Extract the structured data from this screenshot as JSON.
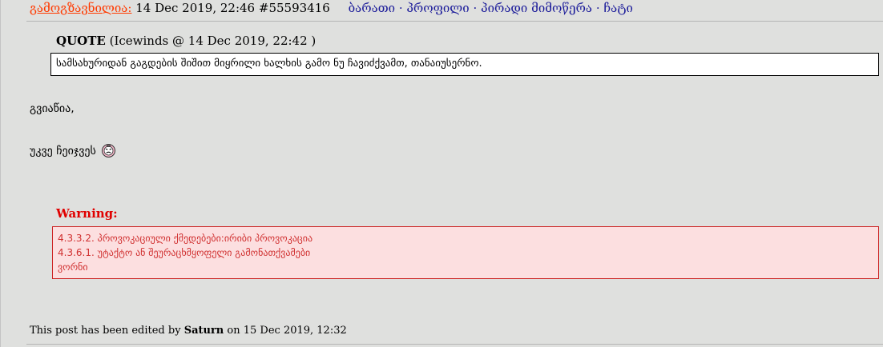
{
  "header": {
    "author": "გამოგზავნილია:",
    "datetime": "14 Dec 2019, 22:46",
    "post_id": "#55593416",
    "links": [
      "ბარათი",
      "პროფილი",
      "პირადი მიმოწერა",
      "ჩატი"
    ],
    "separator": "·"
  },
  "quote": {
    "label": "QUOTE",
    "source": "(Icewinds @ 14 Dec 2019, 22:42 )",
    "text": "სამსახურიდან გაგდების შიშით მიყრილი ხალხის გამო ნუ ჩავიძქვამთ, თანაიუსერნო."
  },
  "body": {
    "line1": "გვიაწია,",
    "line2": "უკვე ჩეიჯვეს",
    "emoji_icon": "angry-face-icon"
  },
  "warning": {
    "label": "Warning:",
    "lines": [
      "4.3.3.2. პროვოკაციული ქმედებები:ირიბი პროვოკაცია",
      "4.3.6.1. უტაქტო ან შეურაცხმყოფელი გამონათქვამები",
      "ვორნი"
    ]
  },
  "edited": {
    "prefix": "This post has been edited by",
    "user": "Saturn",
    "suffix": "on 15 Dec 2019, 12:32"
  }
}
